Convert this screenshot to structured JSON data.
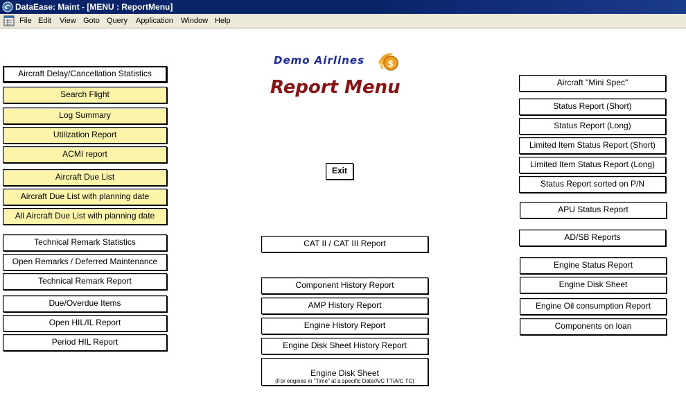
{
  "window": {
    "title": "DataEase: Maint - [MENU : ReportMenu]"
  },
  "menubar": {
    "items": [
      "File",
      "Edit",
      "View",
      "Goto",
      "Query",
      "Application",
      "Window",
      "Help"
    ]
  },
  "branding": {
    "logo_text": "Demo Airlines",
    "heading": "Report Menu",
    "logo_symbol": "$"
  },
  "colors": {
    "title_bar": "#0a246a",
    "button_highlight": "#fcf4a8",
    "heading": "#8b1212",
    "logo": "#1c2d9b",
    "logo_icon": "#f0a020"
  },
  "left_buttons": [
    "Aircraft Delay/Cancellation Statistics",
    "Search Flight",
    "Log Summary",
    "Utilization Report",
    "ACMI report",
    "Aircraft Due List",
    "Aircraft Due List with planning date",
    "All Aircraft Due List with planning date",
    "Technical Remark Statistics",
    "Open Remarks / Deferred Maintenance",
    "Technical Remark Report",
    "Due/Overdue Items",
    "Open HIL/IL Report",
    "Period HIL Report"
  ],
  "center_buttons": {
    "exit": "Exit",
    "cat": "CAT II / CAT III Report",
    "component_history": "Component History Report",
    "amp_history": "AMP History Report",
    "engine_history": "Engine History Report",
    "engine_disk_history": "Engine Disk Sheet History Report",
    "engine_disk_sheet": "Engine Disk Sheet",
    "engine_disk_sheet_sub": "(For engines in \"Time\" at a specific Date/A/C TT/A/C TC)"
  },
  "right_buttons": [
    "Aircraft \"Mini Spec\"",
    "Status Report (Short)",
    "Status Report (Long)",
    "Limited Item Status Report (Short)",
    "Limited Item Status Report (Long)",
    "Status Report sorted on P/N",
    "APU Status Report",
    "AD/SB Reports",
    "Engine Status Report",
    "Engine Disk Sheet",
    "Engine Oil consumption Report",
    "Components on loan"
  ]
}
